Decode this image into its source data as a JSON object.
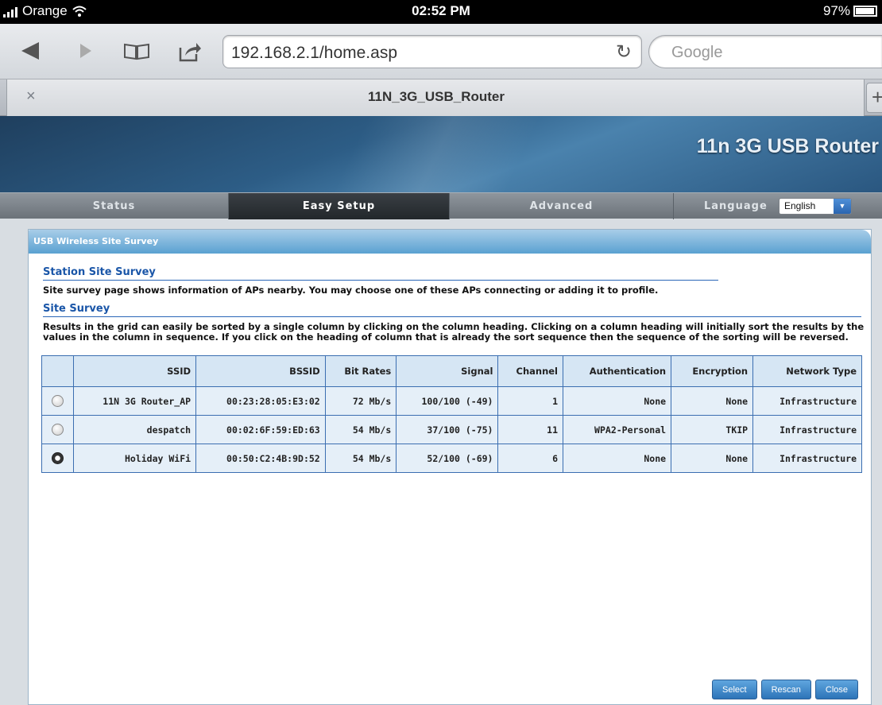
{
  "status_bar": {
    "carrier": "Orange",
    "time": "02:52 PM",
    "battery": "97%"
  },
  "browser": {
    "url": "192.168.2.1/home.asp",
    "search_placeholder": "Google",
    "tab_title": "11N_3G_USB_Router",
    "tab_close": "×",
    "tab_new": "+"
  },
  "router": {
    "banner_title": "11n 3G USB Router",
    "nav": [
      {
        "label": "Status"
      },
      {
        "label": "Easy Setup"
      },
      {
        "label": "Advanced"
      }
    ],
    "language_label": "Language",
    "language_value": "English",
    "panel_title": "USB Wireless Site Survey",
    "station_title": "Station Site Survey",
    "station_desc": "Site survey page shows information of APs nearby. You may choose one of these APs connecting or adding it to profile.",
    "survey_title": "Site Survey",
    "survey_desc": "Results in the grid can easily be sorted by a single column by clicking on the column heading. Clicking on a column heading will initially sort the results by the values in the column in sequence. If you click on the heading of column that is already the sort sequence then the sequence of the sorting will be reversed.",
    "columns": [
      "SSID",
      "BSSID",
      "Bit Rates",
      "Signal",
      "Channel",
      "Authentication",
      "Encryption",
      "Network Type"
    ],
    "rows": [
      {
        "selected": false,
        "ssid": "11N 3G Router_AP",
        "bssid": "00:23:28:05:E3:02",
        "rate": "72 Mb/s",
        "signal": "100/100 (-49)",
        "channel": "1",
        "auth": "None",
        "enc": "None",
        "type": "Infrastructure"
      },
      {
        "selected": false,
        "ssid": "despatch",
        "bssid": "00:02:6F:59:ED:63",
        "rate": "54 Mb/s",
        "signal": "37/100 (-75)",
        "channel": "11",
        "auth": "WPA2-Personal",
        "enc": "TKIP",
        "type": "Infrastructure"
      },
      {
        "selected": true,
        "ssid": "Holiday WiFi",
        "bssid": "00:50:C2:4B:9D:52",
        "rate": "54 Mb/s",
        "signal": "52/100 (-69)",
        "channel": "6",
        "auth": "None",
        "enc": "None",
        "type": "Infrastructure"
      }
    ],
    "buttons": {
      "select": "Select",
      "rescan": "Rescan",
      "close": "Close"
    }
  }
}
